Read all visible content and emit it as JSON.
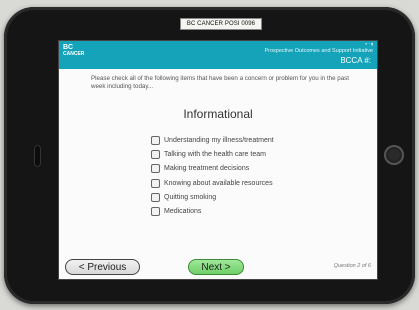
{
  "device": {
    "label_sticker": "BC CANCER POSI 0096"
  },
  "header": {
    "logo_lines": [
      "BC",
      "CANCER"
    ],
    "program_name": "Prospective Outcomes and Support Initiative",
    "bcca_label": "BCCA #:",
    "accent_color": "#14a3b8"
  },
  "question": {
    "instructions": "Please check all of the following items that have been a concern or problem for you in the past week including today...",
    "section_title": "Informational",
    "options": [
      "Understanding my illness/treatment",
      "Talking with the health care team",
      "Making treatment decisions",
      "Knowing about available resources",
      "Quitting smoking",
      "Medications"
    ]
  },
  "footer": {
    "previous_label": "< Previous",
    "next_label": "Next >",
    "progress_text": "Question 2 of 6"
  }
}
